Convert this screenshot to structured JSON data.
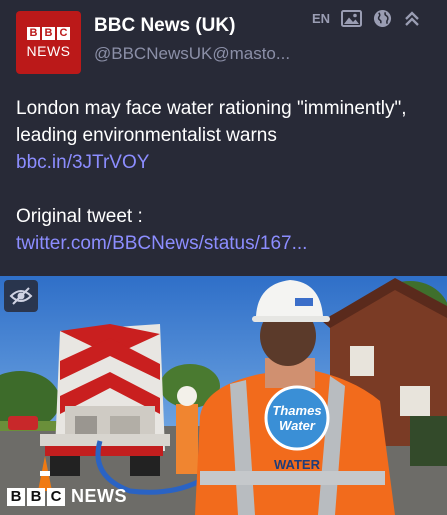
{
  "account": {
    "avatar_letters": [
      "B",
      "B",
      "C"
    ],
    "avatar_word": "NEWS",
    "display_name": "BBC News (UK)",
    "handle": "@BBCNewsUK@masto..."
  },
  "header_icons": {
    "language": "EN",
    "icons": [
      "image-icon",
      "globe-icon",
      "collapse-icon"
    ]
  },
  "post": {
    "text": "London may face water rationing \"imminently\", leading environmentalist warns",
    "link1": "bbc.in/3JTrVOY",
    "original_label": "Original tweet :",
    "link2": "twitter.com/BBCNews/status/167..."
  },
  "media": {
    "vest_brand_line1": "Thames",
    "vest_brand_line2": "Water",
    "vest_word": "WATER",
    "watermark_letters": [
      "B",
      "B",
      "C"
    ],
    "watermark_word": "NEWS"
  },
  "colors": {
    "background": "#282a37",
    "link": "#8c8dff",
    "bbc_red": "#bb1919"
  }
}
